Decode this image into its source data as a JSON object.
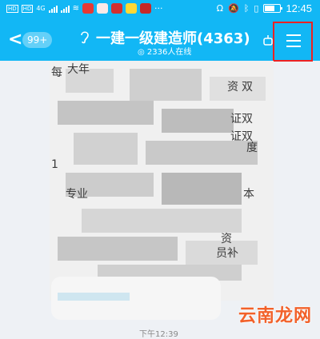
{
  "status_bar": {
    "left_chips": [
      "HD",
      "HD"
    ],
    "network": "4G",
    "time": "12:45"
  },
  "header": {
    "back_glyph": "<",
    "unread_badge": "99+",
    "title": "一建一级建造师(4363)",
    "online_status": "2336人在线",
    "menu_icon": "menu-icon"
  },
  "chat": {
    "visible_fragments": [
      "每",
      "大年",
      "资",
      "双",
      "证双",
      "证双",
      "度",
      "1",
      "专业",
      "本",
      "资",
      "员补"
    ],
    "timestamp": "下午12:39"
  },
  "watermark": "云南龙网",
  "colors": {
    "header": "#12b7f5",
    "highlight_box": "#e22222",
    "watermark": "#f2612a"
  }
}
